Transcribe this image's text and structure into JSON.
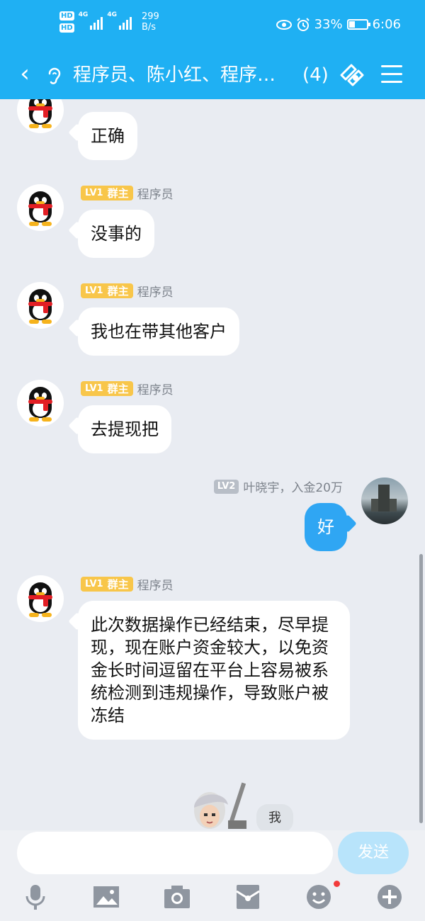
{
  "status_bar": {
    "network_labels": [
      "HD",
      "HD"
    ],
    "signal_label_1": "4G",
    "signal_label_2": "4G",
    "speed_value": "299",
    "speed_unit": "B/s",
    "battery": "33%",
    "time": "6:06"
  },
  "header": {
    "title": "程序员、陈小红、程序员、",
    "member_count": "(4)"
  },
  "messages": [
    {
      "sender": "",
      "role_badge": "",
      "text": "正确"
    },
    {
      "level": "LV1",
      "role_badge": "群主",
      "sender": "程序员",
      "text": "没事的"
    },
    {
      "level": "LV1",
      "role_badge": "群主",
      "sender": "程序员",
      "text": "我也在带其他客户"
    },
    {
      "level": "LV1",
      "role_badge": "群主",
      "sender": "程序员",
      "text": "去提现把"
    },
    {
      "level": "LV2",
      "sender": "叶晓宇，入金20万",
      "text": "好",
      "self": true
    },
    {
      "level": "LV1",
      "role_badge": "群主",
      "sender": "程序员",
      "text": "此次数据操作已经结束，尽早提现，现在账户资金较大，以免资金长时间逗留在平台上容易被系统检测到违规操作，导致账户被冻结"
    }
  ],
  "sticker_hint": "我",
  "input": {
    "placeholder": "",
    "send_label": "发送"
  },
  "colors": {
    "primary": "#1fb0f3",
    "self_bubble": "#2fa6f3",
    "badge_owner": "#f8c64a",
    "send_disabled": "#b8e4fb"
  }
}
